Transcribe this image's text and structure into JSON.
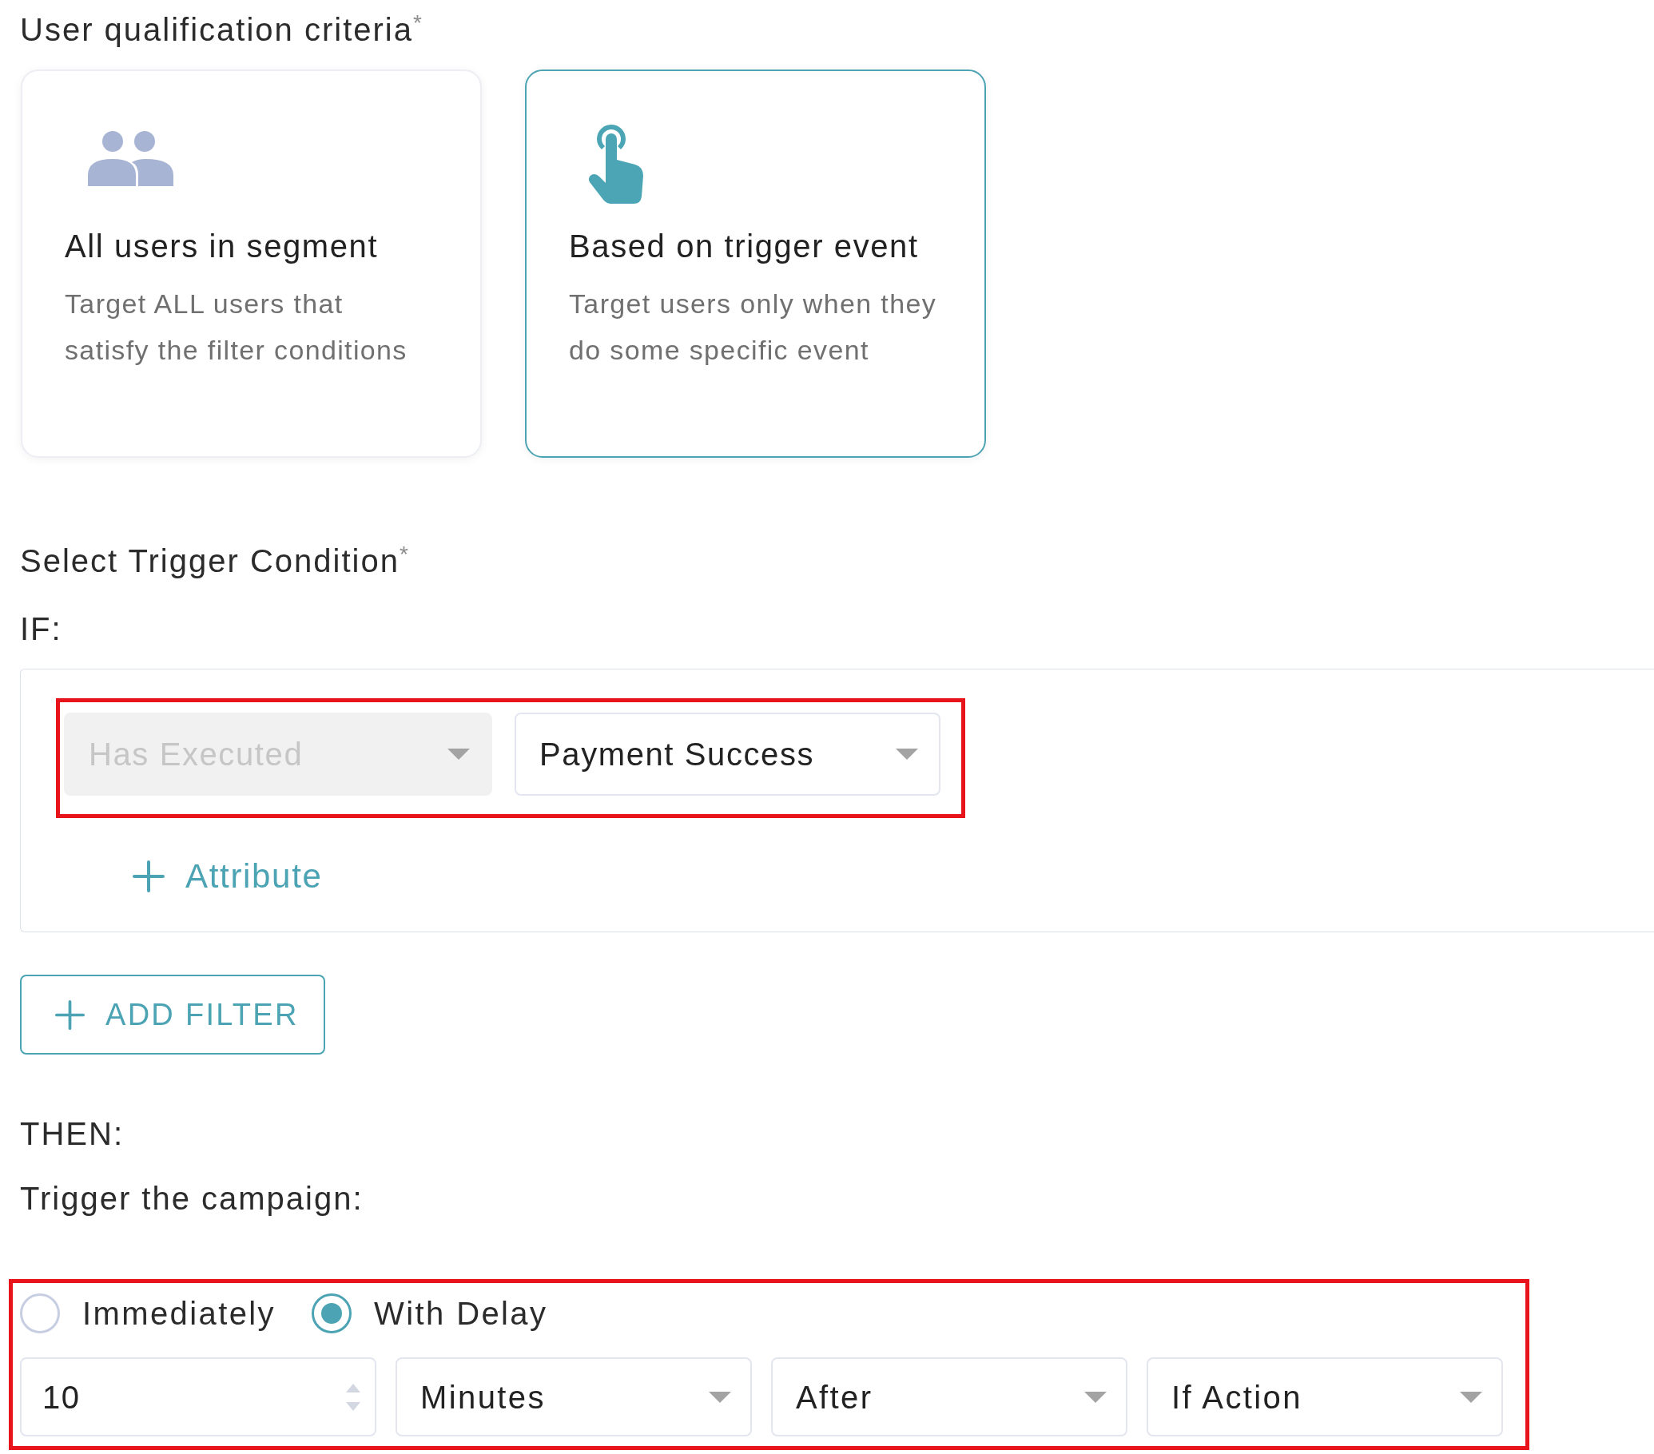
{
  "qualification": {
    "label": "User qualification criteria",
    "required_mark": "*",
    "options": [
      {
        "kind": "segment",
        "title": "All users in segment",
        "description": "Target ALL users that\nsatisfy the filter conditions",
        "selected": false
      },
      {
        "kind": "trigger",
        "title": "Based on trigger event",
        "description": "Target users only when they\ndo some specific event",
        "selected": true
      }
    ]
  },
  "trigger_condition": {
    "label": "Select Trigger Condition",
    "required_mark": "*",
    "if_label": "IF:",
    "condition": {
      "highlighted": true,
      "selects": [
        {
          "value": "Has Executed",
          "disabled": true
        },
        {
          "value": "Payment Success",
          "disabled": false
        }
      ]
    },
    "add_attribute": {
      "label": "Attribute"
    },
    "add_filter": {
      "label": "ADD FILTER"
    }
  },
  "then": {
    "label": "THEN:",
    "instruction": "Trigger the campaign:",
    "highlighted": true,
    "timing": [
      {
        "label": "Immediately",
        "selected": false
      },
      {
        "label": "With Delay",
        "selected": true
      }
    ],
    "delay": [
      {
        "kind": "number",
        "value": "10"
      },
      {
        "kind": "select",
        "value": "Minutes"
      },
      {
        "kind": "select",
        "value": "After"
      },
      {
        "kind": "select",
        "value": "If Action"
      }
    ]
  }
}
